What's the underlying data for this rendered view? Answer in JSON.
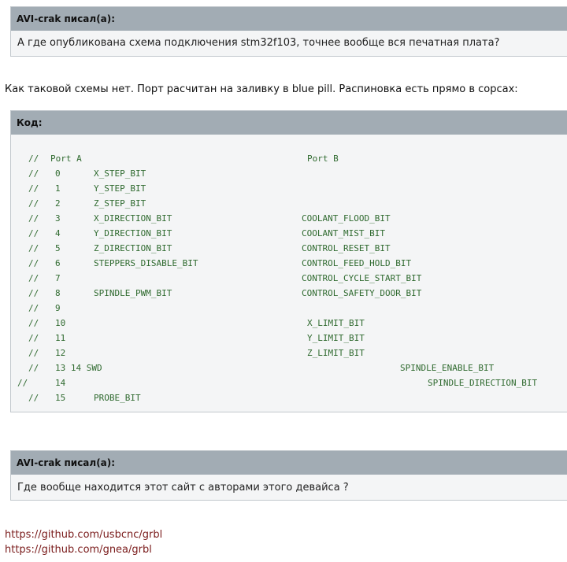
{
  "quote1": {
    "author": "AVI-crak писал(а):",
    "text": "А где опубликована схема подключения stm32f103, точнее вообще вся печатная плата?"
  },
  "post_text": "Как таковой схемы нет. Порт расчитан на заливку в blue pill. Распиновка есть прямо в сорсах:",
  "code": {
    "label": "Код:",
    "lines": [
      {
        "a": "//",
        "b": "Port A",
        "c": "",
        "d": "Port B"
      },
      {
        "a": "//",
        "b": "0",
        "c": "X_STEP_BIT",
        "d": ""
      },
      {
        "a": "//",
        "b": "1",
        "c": "Y_STEP_BIT",
        "d": ""
      },
      {
        "a": "//",
        "b": "2",
        "c": "Z_STEP_BIT",
        "d": ""
      },
      {
        "a": "//",
        "b": "3",
        "c": "X_DIRECTION_BIT",
        "d": "COOLANT_FLOOD_BIT"
      },
      {
        "a": "//",
        "b": "4",
        "c": "Y_DIRECTION_BIT",
        "d": "COOLANT_MIST_BIT"
      },
      {
        "a": "//",
        "b": "5",
        "c": "Z_DIRECTION_BIT",
        "d": "CONTROL_RESET_BIT"
      },
      {
        "a": "//",
        "b": "6",
        "c": "STEPPERS_DISABLE_BIT",
        "d": "CONTROL_FEED_HOLD_BIT"
      },
      {
        "a": "//",
        "b": "7",
        "c": "",
        "d": "CONTROL_CYCLE_START_BIT"
      },
      {
        "a": "//",
        "b": "8",
        "c": "SPINDLE_PWM_BIT",
        "d": "CONTROL_SAFETY_DOOR_BIT"
      },
      {
        "a": "//",
        "b": "9",
        "c": "",
        "d": ""
      },
      {
        "a": "//",
        "b": "10",
        "c": "",
        "d": "X_LIMIT_BIT"
      },
      {
        "a": "//",
        "b": "11",
        "c": "",
        "d": "Y_LIMIT_BIT"
      },
      {
        "a": "//",
        "b": "12",
        "c": "",
        "d": "Z_LIMIT_BIT"
      },
      {
        "a": "//",
        "b": "13 14 SWD",
        "c": "",
        "d": "SPINDLE_ENABLE_BIT"
      },
      {
        "a": "//",
        "b": "14",
        "c": "",
        "d": "SPINDLE_DIRECTION_BIT"
      },
      {
        "a": "//",
        "b": "15",
        "c": "PROBE_BIT",
        "d": ""
      }
    ]
  },
  "quote2": {
    "author": "AVI-crak писал(а):",
    "text": "Где вообще находится этот сайт с авторами этого девайса ?"
  },
  "links": [
    "https://github.com/usbcnc/grbl",
    "https://github.com/gnea/grbl"
  ],
  "colors": {
    "quote_header": "#a2acb4",
    "quote_body": "#f4f5f6",
    "code_text": "#2f6a2f",
    "link": "#7a1b1b"
  }
}
